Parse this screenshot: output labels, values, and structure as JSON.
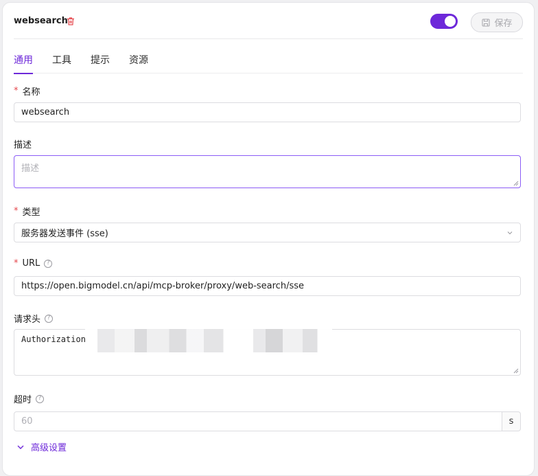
{
  "header": {
    "title": "websearch",
    "save_label": "保存",
    "enabled": true
  },
  "tabs": [
    {
      "label": "通用",
      "active": true
    },
    {
      "label": "工具",
      "active": false
    },
    {
      "label": "提示",
      "active": false
    },
    {
      "label": "资源",
      "active": false
    }
  ],
  "form": {
    "name": {
      "label": "名称",
      "required": true,
      "value": "websearch"
    },
    "description": {
      "label": "描述",
      "required": false,
      "placeholder": "描述",
      "value": ""
    },
    "type": {
      "label": "类型",
      "required": true,
      "value": "服务器发送事件 (sse)"
    },
    "url": {
      "label": "URL",
      "required": true,
      "value": "https://open.bigmodel.cn/api/mcp-broker/proxy/web-search/sse"
    },
    "headers": {
      "label": "请求头",
      "required": false,
      "value": "Authorization"
    },
    "timeout": {
      "label": "超时",
      "required": false,
      "placeholder": "60",
      "unit": "s"
    }
  },
  "advanced": {
    "label": "高级设置"
  },
  "colors": {
    "accent": "#6d28d9",
    "required": "#e5484d",
    "delete": "#e5484d"
  },
  "icons": {
    "delete": "trash-icon",
    "save": "save-icon",
    "help": "help-circle-icon",
    "select": "chevron-down-icon",
    "advanced": "chevron-down-icon"
  }
}
